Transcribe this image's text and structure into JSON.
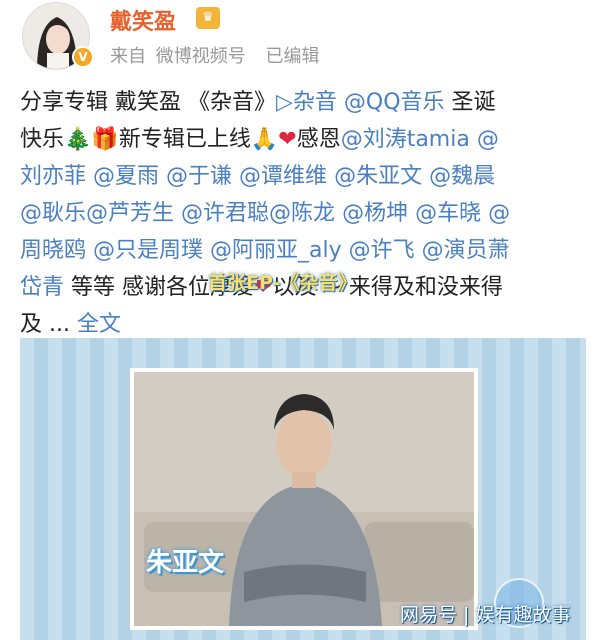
{
  "header": {
    "username": "戴笑盈",
    "badge_icon": "vip-badge-icon",
    "source_prefix": "来自",
    "source_name": "微博视频号",
    "edited": "已编辑"
  },
  "post": {
    "line1": [
      {
        "t": "分享专辑 戴笑盈 《杂音》",
        "c": ""
      },
      {
        "t": "▷杂音",
        "c": "link"
      },
      {
        "t": " ",
        "c": ""
      },
      {
        "t": "@QQ音乐",
        "c": "link"
      },
      {
        "t": " 圣诞",
        "c": ""
      }
    ],
    "line2": [
      {
        "t": "快乐",
        "c": ""
      },
      {
        "t": "🎄",
        "c": "tree"
      },
      {
        "t": "🎁",
        "c": "gift"
      },
      {
        "t": "新专辑已上线",
        "c": ""
      },
      {
        "t": "🙏",
        "c": "hand"
      },
      {
        "t": "❤",
        "c": "heart"
      },
      {
        "t": "感恩",
        "c": ""
      },
      {
        "t": "@刘涛tamia",
        "c": "link"
      },
      {
        "t": " @",
        "c": "link"
      }
    ],
    "line3": [
      {
        "t": "刘亦菲",
        "c": "link"
      },
      {
        "t": " ",
        "c": ""
      },
      {
        "t": "@夏雨",
        "c": "link"
      },
      {
        "t": " ",
        "c": ""
      },
      {
        "t": "@于谦",
        "c": "link"
      },
      {
        "t": " ",
        "c": ""
      },
      {
        "t": "@谭维维",
        "c": "link"
      },
      {
        "t": "  ",
        "c": ""
      },
      {
        "t": "@朱亚文",
        "c": "link"
      },
      {
        "t": " ",
        "c": ""
      },
      {
        "t": "@魏晨",
        "c": "link"
      }
    ],
    "line4": [
      {
        "t": "@耿乐",
        "c": "link"
      },
      {
        "t": "@芦芳生",
        "c": "link"
      },
      {
        "t": " ",
        "c": ""
      },
      {
        "t": "@许君聪",
        "c": "link"
      },
      {
        "t": "@陈龙",
        "c": "link"
      },
      {
        "t": " ",
        "c": ""
      },
      {
        "t": "@杨坤",
        "c": "link"
      },
      {
        "t": " ",
        "c": ""
      },
      {
        "t": "@车晓",
        "c": "link"
      },
      {
        "t": " @",
        "c": "link"
      }
    ],
    "line5": [
      {
        "t": "周晓鸥",
        "c": "link"
      },
      {
        "t": " ",
        "c": ""
      },
      {
        "t": "@只是周璞",
        "c": "link"
      },
      {
        "t": " ",
        "c": ""
      },
      {
        "t": "@阿丽亚_aly",
        "c": "link"
      },
      {
        "t": " ",
        "c": ""
      },
      {
        "t": "@许飞",
        "c": "link"
      },
      {
        "t": " ",
        "c": ""
      },
      {
        "t": "@演员萧",
        "c": "link"
      }
    ],
    "line6": [
      {
        "t": "岱青",
        "c": "link"
      },
      {
        "t": "  等等  感谢各位厚爱",
        "c": ""
      },
      {
        "t": "❤",
        "c": "heart"
      },
      {
        "t": "以及 ~ 来得及和没来得",
        "c": ""
      }
    ],
    "line7": [
      {
        "t": "及 ... ",
        "c": ""
      },
      {
        "t": "全文",
        "c": "link"
      }
    ]
  },
  "media": {
    "person_name": "朱亚文",
    "ep_title": "首张EP-《杂音》",
    "watermark": "网易号 | 娱有趣故事"
  },
  "colors": {
    "username": "#e8612c",
    "link": "#4a7fc4",
    "heart": "#e0263f",
    "card_bg": "#bcd9ea"
  }
}
